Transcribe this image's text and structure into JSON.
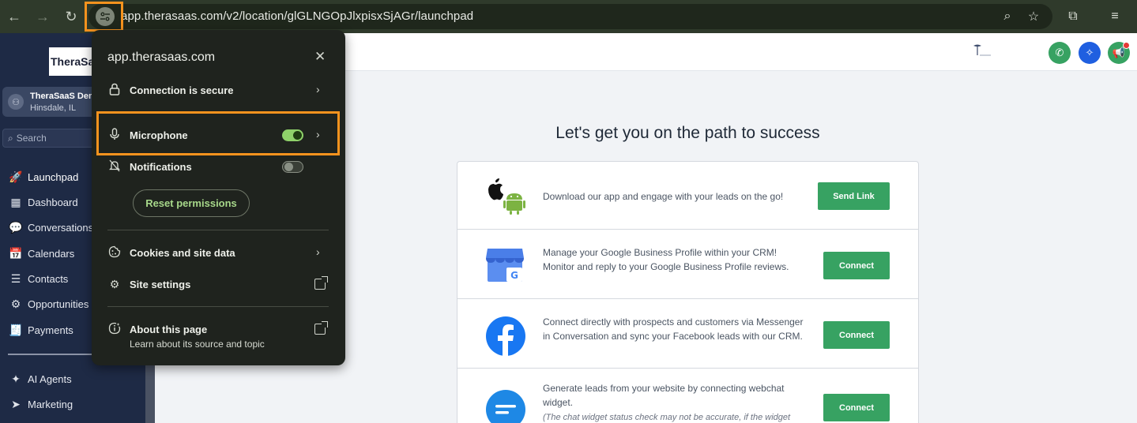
{
  "browser": {
    "url": "app.therasaas.com/v2/location/glGLNGOpJlxpisxSjAGr/launchpad",
    "back_icon": "←",
    "forward_icon": "→",
    "reload_icon": "↻",
    "zoom_icon": "⌕",
    "star_icon": "☆",
    "extensions_icon": "⧉",
    "media_icon": "≡"
  },
  "sidebar": {
    "logo_main": "TheraSa",
    "account_name": "TheraSaaS Dem",
    "account_location": "Hinsdale, IL",
    "search_placeholder": "Search",
    "items": [
      {
        "label": "Launchpad",
        "icon": "🚀"
      },
      {
        "label": "Dashboard",
        "icon": "▦"
      },
      {
        "label": "Conversations",
        "icon": "💬"
      },
      {
        "label": "Calendars",
        "icon": "📅"
      },
      {
        "label": "Contacts",
        "icon": "☰"
      },
      {
        "label": "Opportunities",
        "icon": "⚙"
      },
      {
        "label": "Payments",
        "icon": "🧾"
      },
      {
        "label": "AI Agents",
        "icon": "✦"
      },
      {
        "label": "Marketing",
        "icon": "➤"
      }
    ]
  },
  "header": {
    "phone_icon": "✆",
    "ai_icon": "✧",
    "announce_icon": "📢"
  },
  "main": {
    "title": "Let's get you on the path to success",
    "rows": [
      {
        "text": "Download our app and engage with your leads on the go!",
        "button": "Send Link"
      },
      {
        "text": "Manage your Google Business Profile within your CRM! Monitor and reply to your Google Business Profile reviews.",
        "button": "Connect"
      },
      {
        "text": "Connect directly with prospects and customers via Messenger in Conversation and sync your Facebook leads with our CRM.",
        "button": "Connect"
      },
      {
        "text": "Generate leads from your website by connecting webchat widget.",
        "note": "(The chat widget status check may not be accurate, if the widget",
        "button": "Connect"
      }
    ]
  },
  "popup": {
    "title": "app.therasaas.com",
    "close_icon": "✕",
    "connection_label": "Connection is secure",
    "microphone_label": "Microphone",
    "microphone_on": true,
    "notifications_label": "Notifications",
    "notifications_on": false,
    "reset_label": "Reset permissions",
    "cookies_label": "Cookies and site data",
    "site_settings_label": "Site settings",
    "about_label": "About this page",
    "about_sub": "Learn about its source and topic",
    "chevron": "›"
  },
  "colors": {
    "highlight": "#f7931e",
    "toggle_on": "#8fd16a",
    "green_button": "#37a262",
    "sidebar_bg": "#1e2a45"
  }
}
